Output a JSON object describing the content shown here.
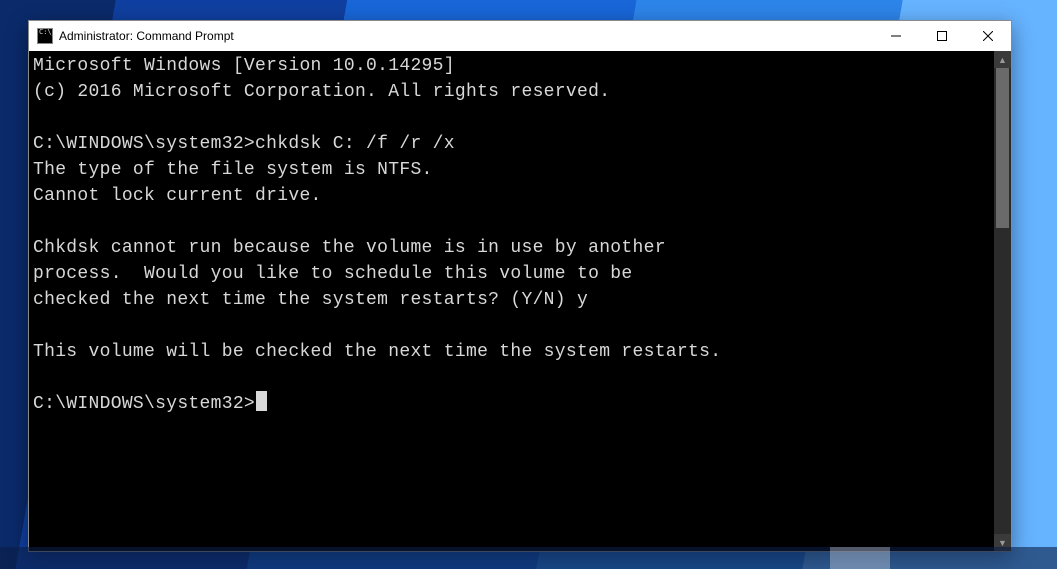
{
  "window": {
    "title": "Administrator: Command Prompt"
  },
  "terminal": {
    "lines": [
      "Microsoft Windows [Version 10.0.14295]",
      "(c) 2016 Microsoft Corporation. All rights reserved.",
      "",
      "C:\\WINDOWS\\system32>chkdsk C: /f /r /x",
      "The type of the file system is NTFS.",
      "Cannot lock current drive.",
      "",
      "Chkdsk cannot run because the volume is in use by another",
      "process.  Would you like to schedule this volume to be",
      "checked the next time the system restarts? (Y/N) y",
      "",
      "This volume will be checked the next time the system restarts.",
      ""
    ],
    "prompt": "C:\\WINDOWS\\system32>"
  }
}
